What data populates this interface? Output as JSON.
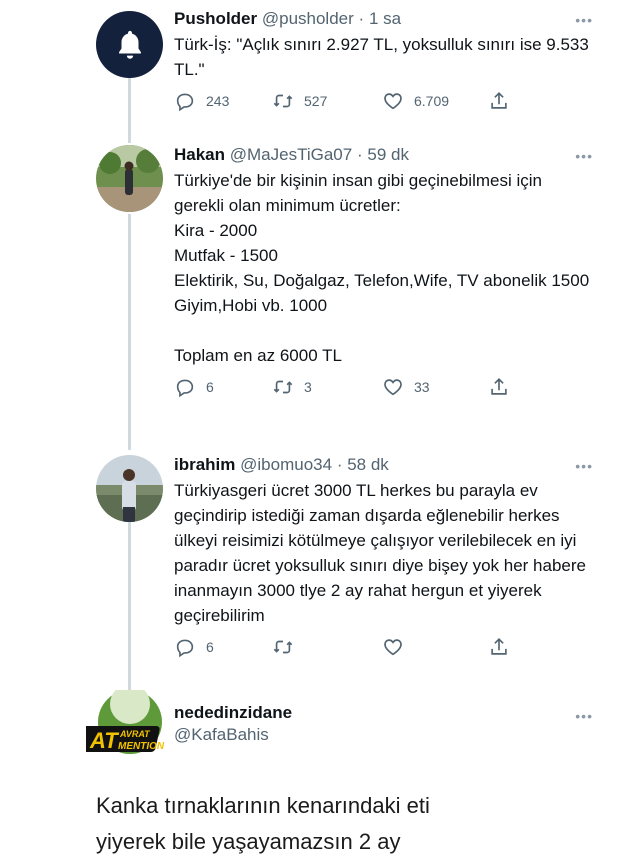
{
  "tweets": [
    {
      "name": "Pusholder",
      "handle": "@pusholder",
      "time": "1 sa",
      "text": "Türk-İş: \"Açlık sınırı 2.927 TL, yoksulluk sınırı ise 9.533 TL.\"",
      "reply_count": "243",
      "retweet_count": "527",
      "like_count": "6.709",
      "avatar_icon": "bell-icon"
    },
    {
      "name": "Hakan",
      "handle": "@MaJesTiGa07",
      "time": "59 dk",
      "text": "Türkiye'de bir kişinin insan gibi geçinebilmesi için gerekli olan minimum ücretler:\nKira - 2000\nMutfak - 1500\nElektirik, Su, Doğalgaz, Telefon,Wife, TV abonelik 1500\nGiyim,Hobi vb. 1000\n\nToplam en az 6000 TL",
      "reply_count": "6",
      "retweet_count": "3",
      "like_count": "33"
    },
    {
      "name": "ibrahim",
      "handle": "@ibomuo34",
      "time": "58 dk",
      "text": "Türkiyasgeri ücret 3000 TL herkes bu parayla ev geçindirip istediği zaman dışarda eğlenebilir herkes ülkeyi reisimizi kötülmeye çalışıyor verilebilecek en iyi paradır ücret yoksulluk sınırı diye bişey yok her habere inanmayın 3000 tlye 2 ay rahat hergun et yiyerek geçirebilirim",
      "reply_count": "6",
      "retweet_count": "",
      "like_count": ""
    }
  ],
  "reply": {
    "name": "nededinzidane",
    "handle": "@KafaBahis",
    "logo_text_1": "AT",
    "logo_text_2": "AVRAT",
    "logo_text_3": "MENTION",
    "text": "Kanka tırnaklarının kenarındaki eti\nyiyerek bile yaşayamazsın 2 ay"
  },
  "separator": "·",
  "more_glyph": "•••",
  "colors": {
    "text": "#0f1419",
    "muted": "#536471",
    "thread_line": "#cfd9de",
    "bell_bg": "#14213d"
  }
}
